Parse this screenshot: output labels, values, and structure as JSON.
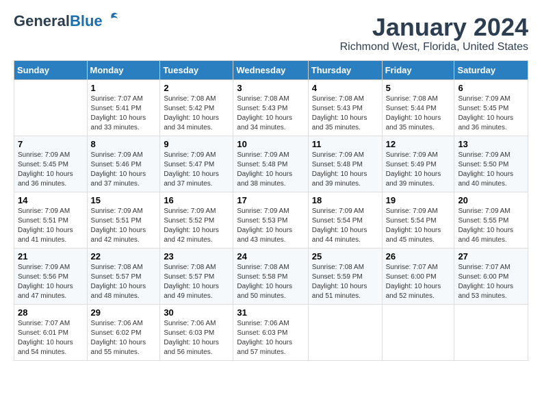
{
  "header": {
    "logo_general": "General",
    "logo_blue": "Blue",
    "title": "January 2024",
    "subtitle": "Richmond West, Florida, United States"
  },
  "calendar": {
    "days_of_week": [
      "Sunday",
      "Monday",
      "Tuesday",
      "Wednesday",
      "Thursday",
      "Friday",
      "Saturday"
    ],
    "weeks": [
      [
        {
          "num": "",
          "empty": true
        },
        {
          "num": "1",
          "sunrise": "7:07 AM",
          "sunset": "5:41 PM",
          "daylight": "10 hours and 33 minutes."
        },
        {
          "num": "2",
          "sunrise": "7:08 AM",
          "sunset": "5:42 PM",
          "daylight": "10 hours and 34 minutes."
        },
        {
          "num": "3",
          "sunrise": "7:08 AM",
          "sunset": "5:43 PM",
          "daylight": "10 hours and 34 minutes."
        },
        {
          "num": "4",
          "sunrise": "7:08 AM",
          "sunset": "5:43 PM",
          "daylight": "10 hours and 35 minutes."
        },
        {
          "num": "5",
          "sunrise": "7:08 AM",
          "sunset": "5:44 PM",
          "daylight": "10 hours and 35 minutes."
        },
        {
          "num": "6",
          "sunrise": "7:09 AM",
          "sunset": "5:45 PM",
          "daylight": "10 hours and 36 minutes."
        }
      ],
      [
        {
          "num": "7",
          "sunrise": "7:09 AM",
          "sunset": "5:45 PM",
          "daylight": "10 hours and 36 minutes."
        },
        {
          "num": "8",
          "sunrise": "7:09 AM",
          "sunset": "5:46 PM",
          "daylight": "10 hours and 37 minutes."
        },
        {
          "num": "9",
          "sunrise": "7:09 AM",
          "sunset": "5:47 PM",
          "daylight": "10 hours and 37 minutes."
        },
        {
          "num": "10",
          "sunrise": "7:09 AM",
          "sunset": "5:48 PM",
          "daylight": "10 hours and 38 minutes."
        },
        {
          "num": "11",
          "sunrise": "7:09 AM",
          "sunset": "5:48 PM",
          "daylight": "10 hours and 39 minutes."
        },
        {
          "num": "12",
          "sunrise": "7:09 AM",
          "sunset": "5:49 PM",
          "daylight": "10 hours and 39 minutes."
        },
        {
          "num": "13",
          "sunrise": "7:09 AM",
          "sunset": "5:50 PM",
          "daylight": "10 hours and 40 minutes."
        }
      ],
      [
        {
          "num": "14",
          "sunrise": "7:09 AM",
          "sunset": "5:51 PM",
          "daylight": "10 hours and 41 minutes."
        },
        {
          "num": "15",
          "sunrise": "7:09 AM",
          "sunset": "5:51 PM",
          "daylight": "10 hours and 42 minutes."
        },
        {
          "num": "16",
          "sunrise": "7:09 AM",
          "sunset": "5:52 PM",
          "daylight": "10 hours and 42 minutes."
        },
        {
          "num": "17",
          "sunrise": "7:09 AM",
          "sunset": "5:53 PM",
          "daylight": "10 hours and 43 minutes."
        },
        {
          "num": "18",
          "sunrise": "7:09 AM",
          "sunset": "5:54 PM",
          "daylight": "10 hours and 44 minutes."
        },
        {
          "num": "19",
          "sunrise": "7:09 AM",
          "sunset": "5:54 PM",
          "daylight": "10 hours and 45 minutes."
        },
        {
          "num": "20",
          "sunrise": "7:09 AM",
          "sunset": "5:55 PM",
          "daylight": "10 hours and 46 minutes."
        }
      ],
      [
        {
          "num": "21",
          "sunrise": "7:09 AM",
          "sunset": "5:56 PM",
          "daylight": "10 hours and 47 minutes."
        },
        {
          "num": "22",
          "sunrise": "7:08 AM",
          "sunset": "5:57 PM",
          "daylight": "10 hours and 48 minutes."
        },
        {
          "num": "23",
          "sunrise": "7:08 AM",
          "sunset": "5:57 PM",
          "daylight": "10 hours and 49 minutes."
        },
        {
          "num": "24",
          "sunrise": "7:08 AM",
          "sunset": "5:58 PM",
          "daylight": "10 hours and 50 minutes."
        },
        {
          "num": "25",
          "sunrise": "7:08 AM",
          "sunset": "5:59 PM",
          "daylight": "10 hours and 51 minutes."
        },
        {
          "num": "26",
          "sunrise": "7:07 AM",
          "sunset": "6:00 PM",
          "daylight": "10 hours and 52 minutes."
        },
        {
          "num": "27",
          "sunrise": "7:07 AM",
          "sunset": "6:00 PM",
          "daylight": "10 hours and 53 minutes."
        }
      ],
      [
        {
          "num": "28",
          "sunrise": "7:07 AM",
          "sunset": "6:01 PM",
          "daylight": "10 hours and 54 minutes."
        },
        {
          "num": "29",
          "sunrise": "7:06 AM",
          "sunset": "6:02 PM",
          "daylight": "10 hours and 55 minutes."
        },
        {
          "num": "30",
          "sunrise": "7:06 AM",
          "sunset": "6:03 PM",
          "daylight": "10 hours and 56 minutes."
        },
        {
          "num": "31",
          "sunrise": "7:06 AM",
          "sunset": "6:03 PM",
          "daylight": "10 hours and 57 minutes."
        },
        {
          "num": "",
          "empty": true
        },
        {
          "num": "",
          "empty": true
        },
        {
          "num": "",
          "empty": true
        }
      ]
    ]
  }
}
